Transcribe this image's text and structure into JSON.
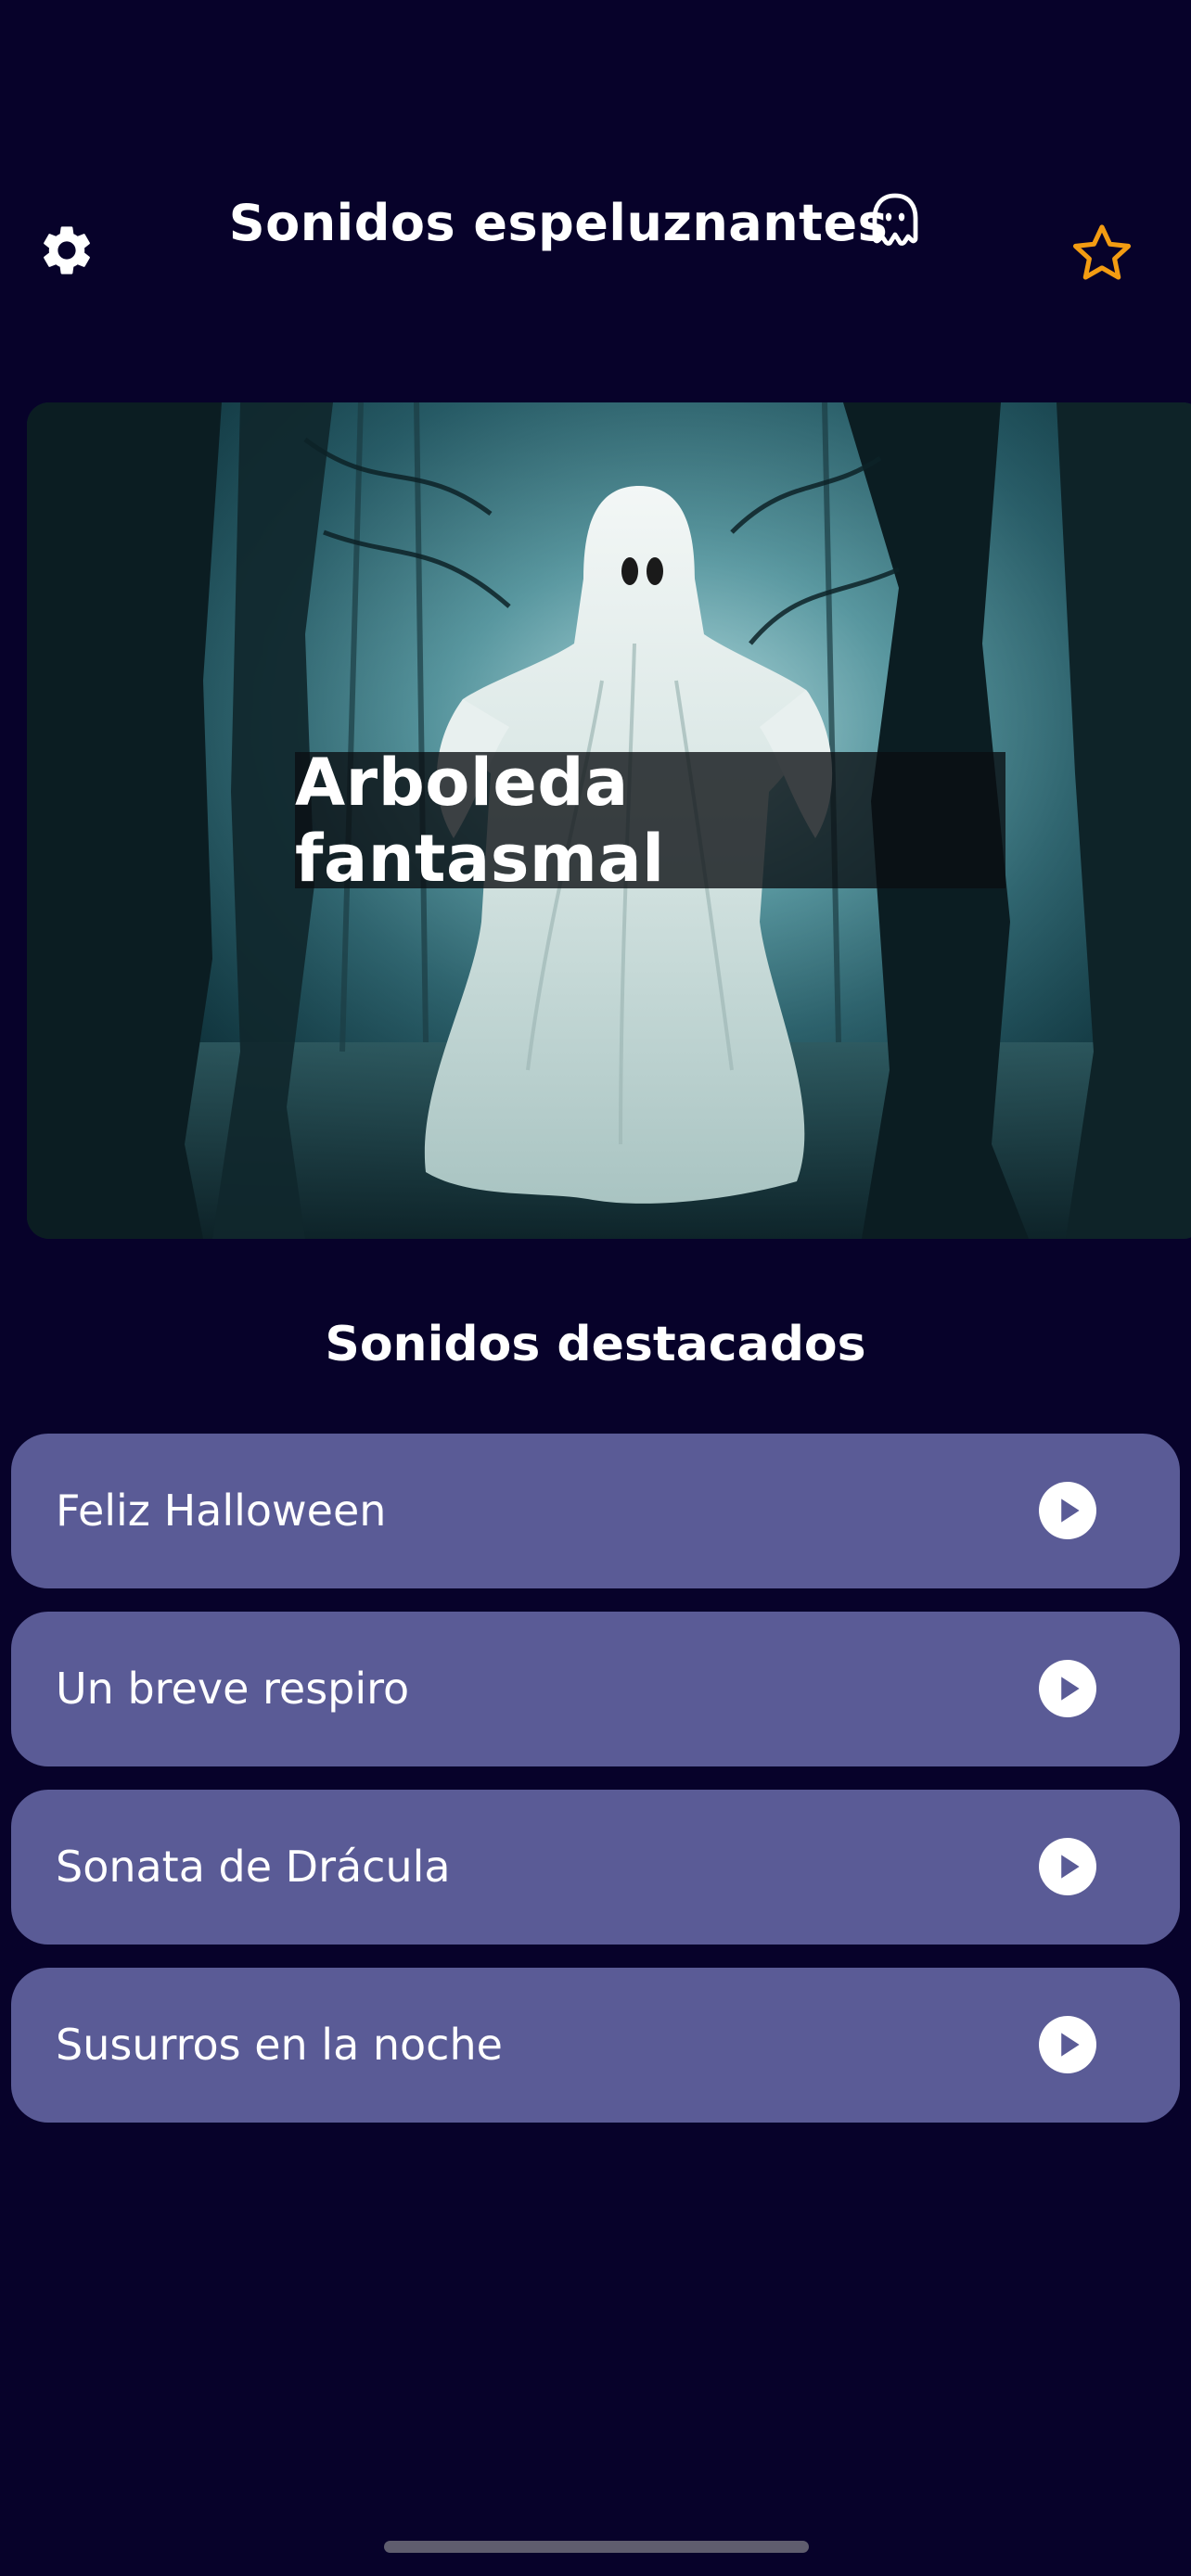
{
  "header": {
    "title": "Sonidos espeluznantes",
    "settings_icon": "gear-icon",
    "title_icon": "ghost-icon",
    "favorite_icon": "star-outline-icon"
  },
  "hero": {
    "label": "Arboleda fantasmal",
    "image": "ghost-in-forest"
  },
  "featured": {
    "title": "Sonidos destacados",
    "items": [
      {
        "label": "Feliz Halloween"
      },
      {
        "label": "Un breve respiro"
      },
      {
        "label": "Sonata de Drácula"
      },
      {
        "label": "Susurros en la noche"
      }
    ]
  },
  "colors": {
    "background": "#07022a",
    "card": "#5a5b96",
    "accent": "#f39c12",
    "text": "#ffffff"
  }
}
